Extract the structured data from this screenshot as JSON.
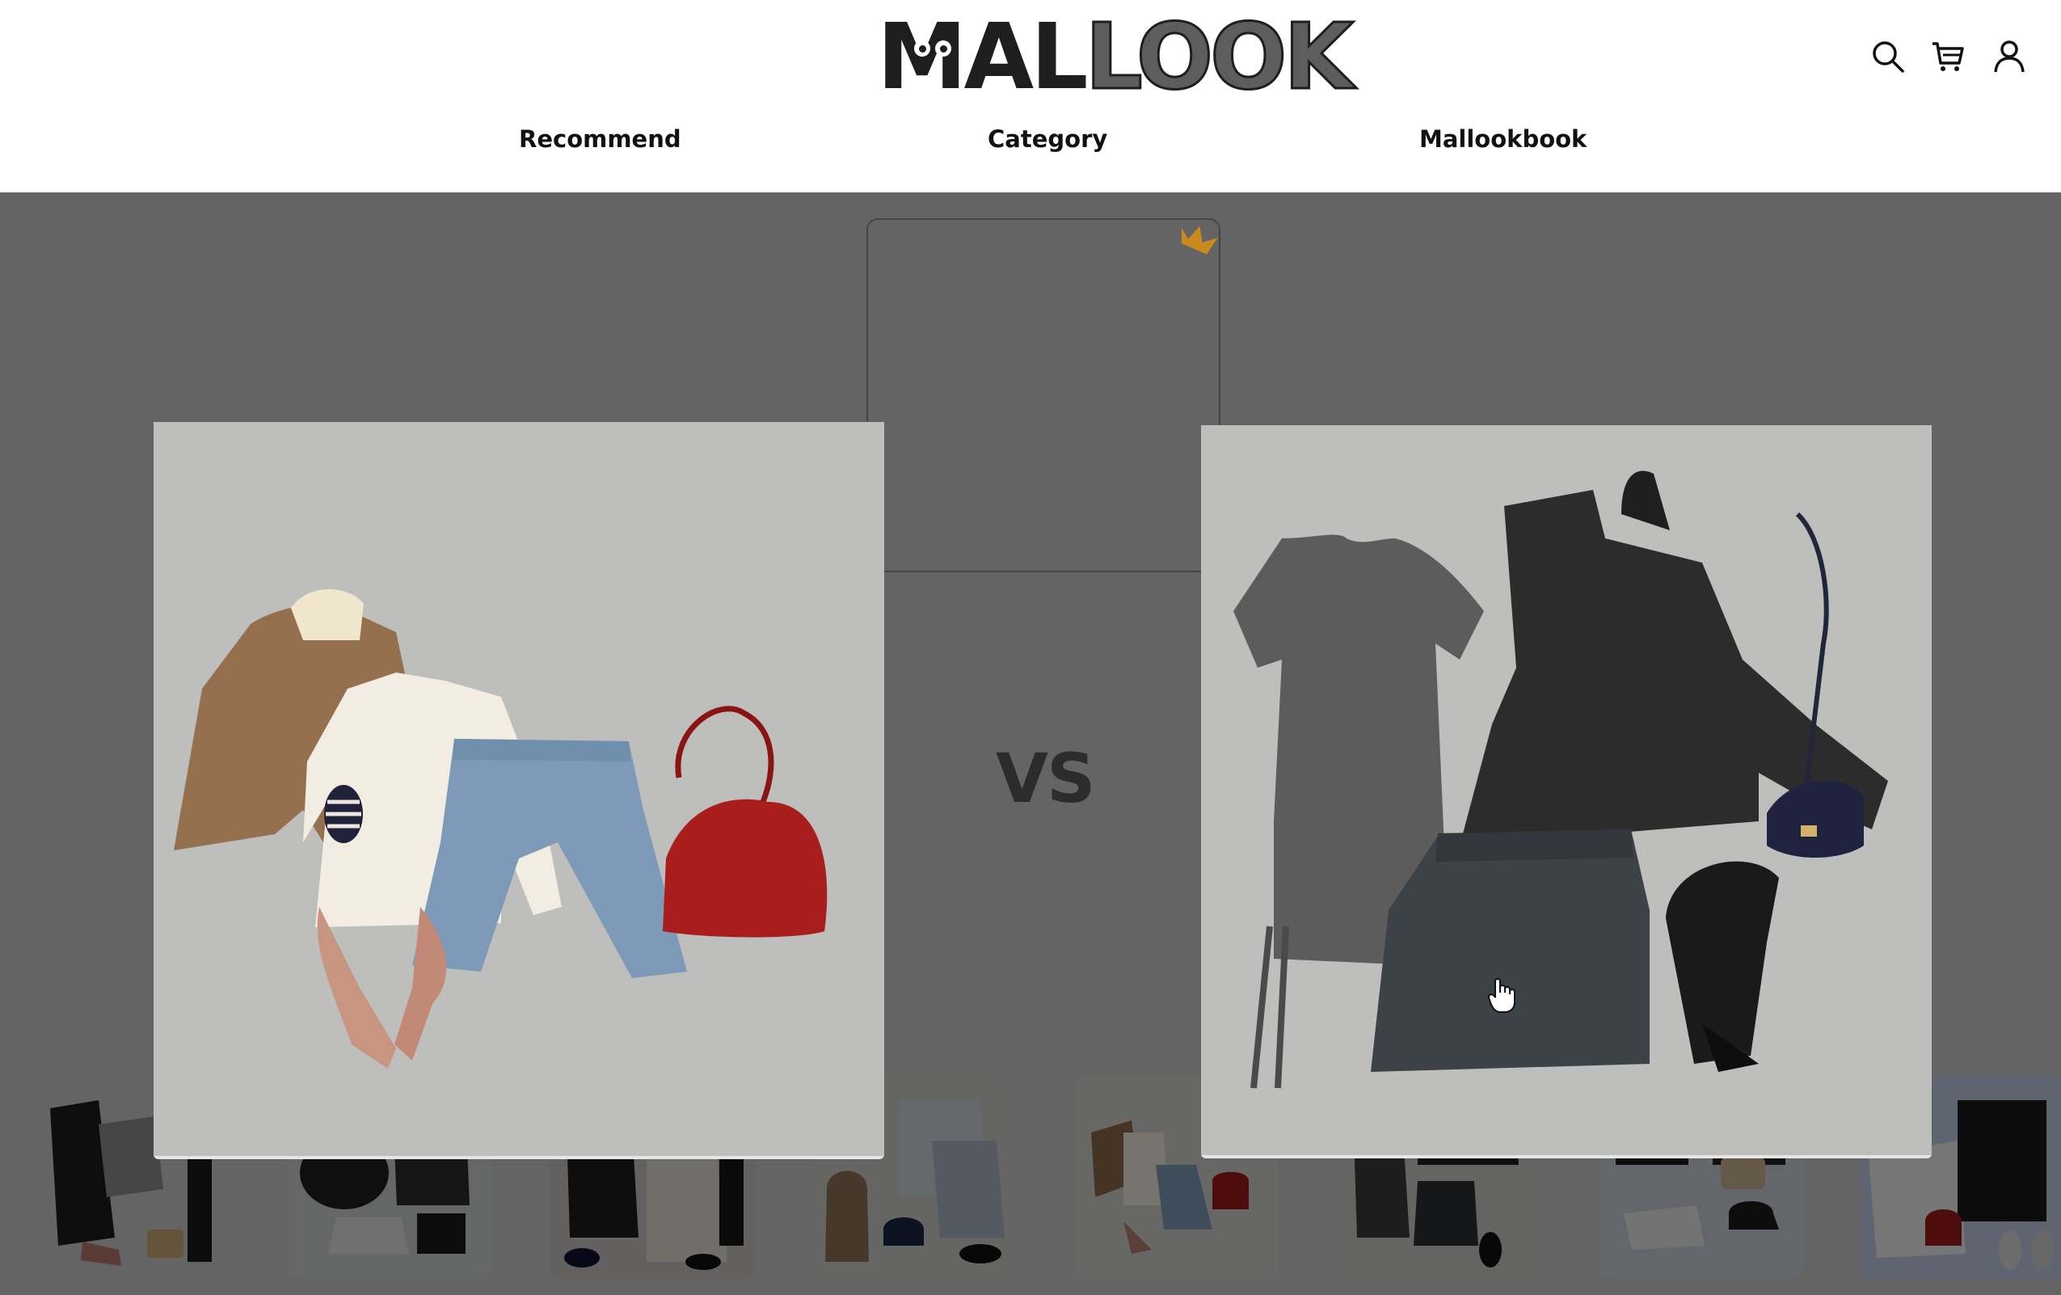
{
  "header": {
    "logo_left": "MAL",
    "logo_right": "LOOK",
    "nav": [
      {
        "label": "Recommend"
      },
      {
        "label": "Category"
      },
      {
        "label": "Mallookbook"
      }
    ],
    "icons": [
      "search-icon",
      "cart-icon",
      "user-icon"
    ]
  },
  "battle": {
    "vs_label": "VS",
    "left_outfit": {
      "items": [
        "brown shearling jacket",
        "cream sweater with striped elbow patch",
        "light wash denim capri jeans",
        "red leather shoulder bag",
        "nude pointed pumps"
      ]
    },
    "right_outfit": {
      "items": [
        "grey ribbed t-shirt dress",
        "black funnel-neck jacket",
        "navy crossbody bag",
        "dark denim mini skirt",
        "black lace-up chunky loafers"
      ]
    },
    "winner_icon": "crown-icon"
  },
  "colors": {
    "overlay": "#808080",
    "card_bg": "#bebebc",
    "crown": "#c98a1e"
  },
  "thumbnails": [
    {
      "name": "thumb-1"
    },
    {
      "name": "thumb-2"
    },
    {
      "name": "thumb-3"
    },
    {
      "name": "thumb-4"
    },
    {
      "name": "thumb-5"
    },
    {
      "name": "thumb-6"
    },
    {
      "name": "thumb-7"
    },
    {
      "name": "thumb-8"
    }
  ]
}
